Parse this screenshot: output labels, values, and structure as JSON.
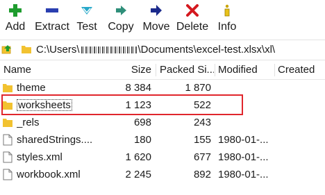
{
  "toolbar": {
    "add": "Add",
    "extract": "Extract",
    "test": "Test",
    "copy": "Copy",
    "move": "Move",
    "delete": "Delete",
    "info": "Info"
  },
  "address": {
    "path_prefix": "C:\\Users\\",
    "path_suffix": "\\Documents\\excel-test.xlsx\\xl\\"
  },
  "columns": {
    "name": "Name",
    "size": "Size",
    "packed": "Packed Si...",
    "modified": "Modified",
    "created": "Created"
  },
  "files": [
    {
      "name": "theme",
      "size": "8 384",
      "packed": "1 870",
      "modified": "",
      "type": "folder"
    },
    {
      "name": "worksheets",
      "size": "1 123",
      "packed": "522",
      "modified": "",
      "type": "folder"
    },
    {
      "name": "_rels",
      "size": "698",
      "packed": "243",
      "modified": "",
      "type": "folder"
    },
    {
      "name": "sharedStrings....",
      "size": "180",
      "packed": "155",
      "modified": "1980-01-...",
      "type": "file"
    },
    {
      "name": "styles.xml",
      "size": "1 620",
      "packed": "677",
      "modified": "1980-01-...",
      "type": "file"
    },
    {
      "name": "workbook.xml",
      "size": "2 245",
      "packed": "892",
      "modified": "1980-01-...",
      "type": "file"
    }
  ],
  "colors": {
    "add": "#1e9c2e",
    "extract": "#2a3fb0",
    "test": "#27a8c9",
    "copy": "#2f8f7a",
    "move": "#1b2a8c",
    "delete": "#d4191f",
    "folder": "#f2c230",
    "highlight": "#e0262c"
  }
}
